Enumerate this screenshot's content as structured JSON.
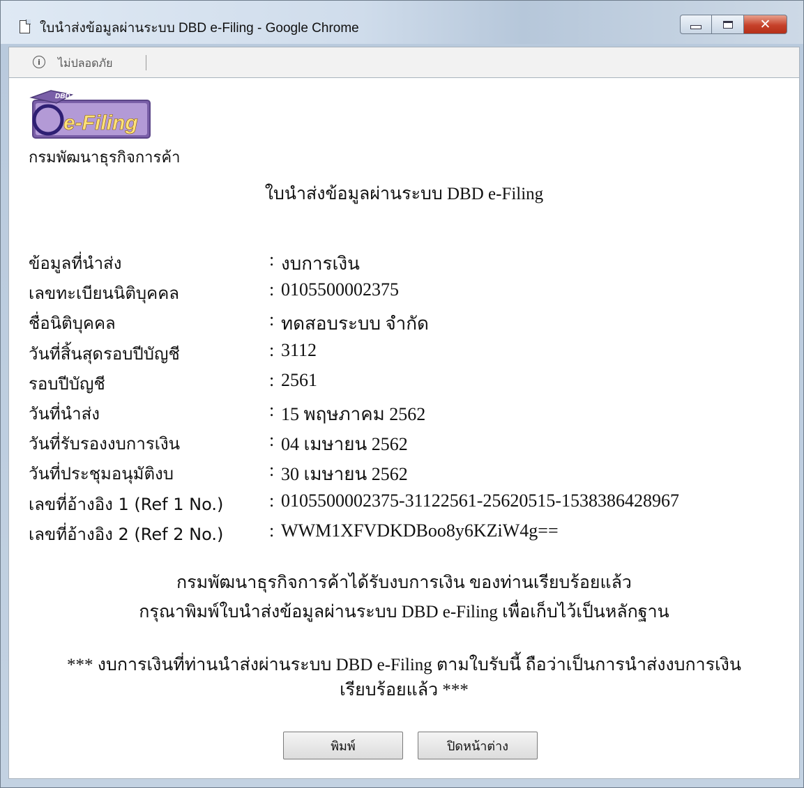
{
  "window": {
    "title": "ใบนำส่งข้อมูลผ่านระบบ DBD e-Filing - Google Chrome"
  },
  "address_bar": {
    "security_status": "ไม่ปลอดภัย"
  },
  "logo": {
    "top_text": "DBD",
    "main_text": "e-Filing"
  },
  "page": {
    "department": "กรมพัฒนาธุรกิจการค้า",
    "document_title": "ใบนำส่งข้อมูลผ่านระบบ DBD e-Filing",
    "fields": [
      {
        "label": "ข้อมูลที่นำส่ง",
        "value": "งบการเงิน"
      },
      {
        "label": "เลขทะเบียนนิติบุคคล",
        "value": "0105500002375"
      },
      {
        "label": "ชื่อนิติบุคคล",
        "value": "ทดสอบระบบ จำกัด"
      },
      {
        "label": "วันที่สิ้นสุดรอบปีบัญชี",
        "value": "3112"
      },
      {
        "label": "รอบปีบัญชี",
        "value": "2561"
      },
      {
        "label": "วันที่นำส่ง",
        "value": "15 พฤษภาคม 2562"
      },
      {
        "label": "วันที่รับรองงบการเงิน",
        "value": "04 เมษายน 2562"
      },
      {
        "label": "วันที่ประชุมอนุมัติงบ",
        "value": "30 เมษายน 2562"
      },
      {
        "label": "เลขที่อ้างอิง 1 (Ref 1 No.)",
        "value": "0105500002375-31122561-25620515-1538386428967"
      },
      {
        "label": "เลขที่อ้างอิง 2 (Ref 2 No.)",
        "value": "WWM1XFVDKDBoo8y6KZiW4g=="
      }
    ],
    "separator": ":",
    "confirmation_line1": "กรมพัฒนาธุรกิจการค้าได้รับงบการเงิน ของท่านเรียบร้อยแล้ว",
    "confirmation_line2": "กรุณาพิมพ์ใบนำส่งข้อมูลผ่านระบบ DBD e-Filing เพื่อเก็บไว้เป็นหลักฐาน",
    "notice_line1": "*** งบการเงินที่ท่านนำส่งผ่านระบบ DBD e-Filing ตามใบรับนี้ ถือว่าเป็นการนำส่งงบการเงิน",
    "notice_line2": "เรียบร้อยแล้ว ***"
  },
  "buttons": {
    "print": "พิมพ์",
    "close": "ปิดหน้าต่าง"
  }
}
